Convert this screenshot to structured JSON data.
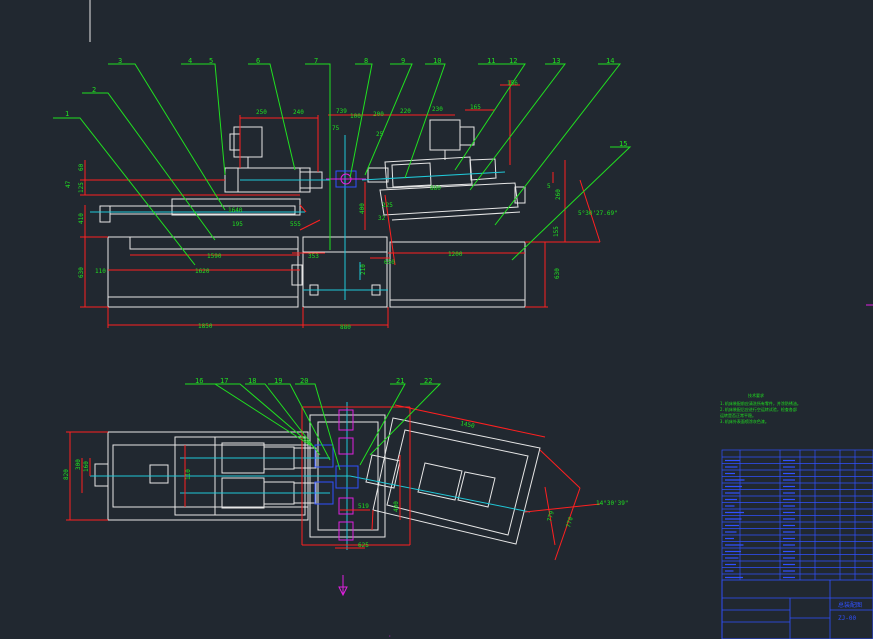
{
  "colors": {
    "background": "#212830",
    "outline": "#e6e6e6",
    "dimension": "#ff2020",
    "leader": "#20e020",
    "center": "#20c8d8",
    "blue": "#3050ff",
    "magenta": "#e020e0",
    "title_block": "#3050ff"
  },
  "balloons_top": [
    "1",
    "2",
    "3",
    "4",
    "5",
    "6",
    "7",
    "8",
    "9",
    "10",
    "11",
    "12",
    "13",
    "14",
    "15"
  ],
  "balloons_bottom": [
    "16",
    "17",
    "18",
    "19",
    "20",
    "21",
    "22"
  ],
  "dims_front": {
    "d1850": "1850",
    "d1640": "1640",
    "d1620": "1620",
    "d1590": "1590",
    "d1200": "1200",
    "d880": "880",
    "d880b": "880",
    "d630l": "630",
    "d630r": "630",
    "d410": "410",
    "d400": "400",
    "d155": "155",
    "d250": "250",
    "d240": "240",
    "d230": "230",
    "d220": "220",
    "d200": "200",
    "d739": "739",
    "d165": "165",
    "d100": "100",
    "d75": "75",
    "d25": "25",
    "d125": "125",
    "d60": "60",
    "d47": "47",
    "d195": "195",
    "d110": "110",
    "d210": "210",
    "d260": "260",
    "d5": "5",
    "d555": "555",
    "d225": "225",
    "d32": "32",
    "d650": "650",
    "d353": "353",
    "d156": "156",
    "angle": "5°30'27.69\""
  },
  "dims_plan": {
    "d1450": "1450",
    "d770": "770",
    "d779": "779",
    "d400": "400",
    "d519": "519",
    "d625": "625",
    "d820": "820",
    "d300": "300",
    "d160": "160",
    "d110": "110",
    "angle": "14°30'39\""
  },
  "notes": {
    "heading": "技术要求",
    "lines": [
      "1.机床装配前应清洗所有零件，并涂防锈油。",
      "2.机床装配后应进行空运转试验，检查各部",
      "  运转是否正常平稳。",
      "3.机床外表面喷涂灰色漆。"
    ]
  },
  "title_block": {
    "title": "总装配图",
    "drawing_no": "ZJ-00"
  }
}
